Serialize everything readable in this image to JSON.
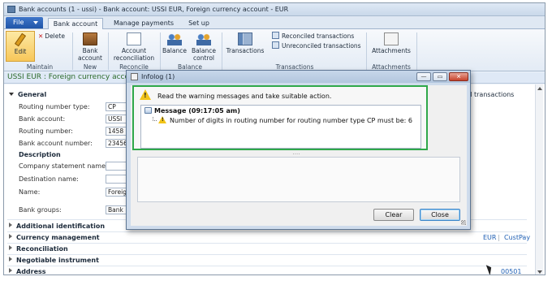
{
  "window": {
    "title": "Bank accounts (1 - ussi) - Bank account: USSI EUR, Foreign currency account - EUR"
  },
  "tabs": {
    "file": "File",
    "items": [
      "Bank account",
      "Manage payments",
      "Set up"
    ]
  },
  "ribbon": {
    "edit": "Edit",
    "delete": "Delete",
    "maintain_label": "Maintain",
    "new_button": [
      "Bank",
      "account"
    ],
    "new_label": "New",
    "account_reconciliation": [
      "Account",
      "reconciliation"
    ],
    "reconcile_label": "Reconcile",
    "balance": "Balance",
    "balance_control": [
      "Balance",
      "control"
    ],
    "balance_label": "Balance",
    "transactions": "Transactions",
    "reconciled_transactions": "Reconciled transactions",
    "unreconciled_transactions": "Unreconciled transactions",
    "transactions_label": "Transactions",
    "attachments": "Attachments",
    "attachments_label": "Attachments"
  },
  "form": {
    "header_title": "USSI EUR : Foreign currency account",
    "general": "General",
    "fields": [
      {
        "label": "Routing number type:",
        "value": "CP"
      },
      {
        "label": "Bank account:",
        "value": "USSI"
      },
      {
        "label": "Routing number:",
        "value": "1458"
      },
      {
        "label": "Bank account number:",
        "value": "23456"
      }
    ],
    "description_header": "Description",
    "desc_fields": [
      {
        "label": "Company statement name:",
        "value": ""
      },
      {
        "label": "Destination name:",
        "value": ""
      },
      {
        "label": "Name:",
        "value": "Foreign"
      },
      {
        "label": "Bank groups:",
        "value": "Bank"
      }
    ],
    "collapsed_sections": [
      "Additional identification",
      "Currency management",
      "Reconciliation",
      "Negotiable instrument",
      "Address"
    ],
    "right_side": {
      "all_transactions": "ll transactions",
      "currency": "EUR",
      "separator": "|",
      "custpay": "CustPay",
      "address_code": "00501"
    }
  },
  "infolog": {
    "title": "Infolog (1)",
    "warning": "Read the warning messages and take suitable action.",
    "message_header": "Message (09:17:05 am)",
    "message_text": "Number of digits in routing number for routing number type CP must be: 6",
    "splitter_dots": "....",
    "clear": "Clear",
    "close": "Close",
    "minimize_glyph": "—",
    "maximize_glyph": "▭",
    "close_glyph": "✕"
  }
}
